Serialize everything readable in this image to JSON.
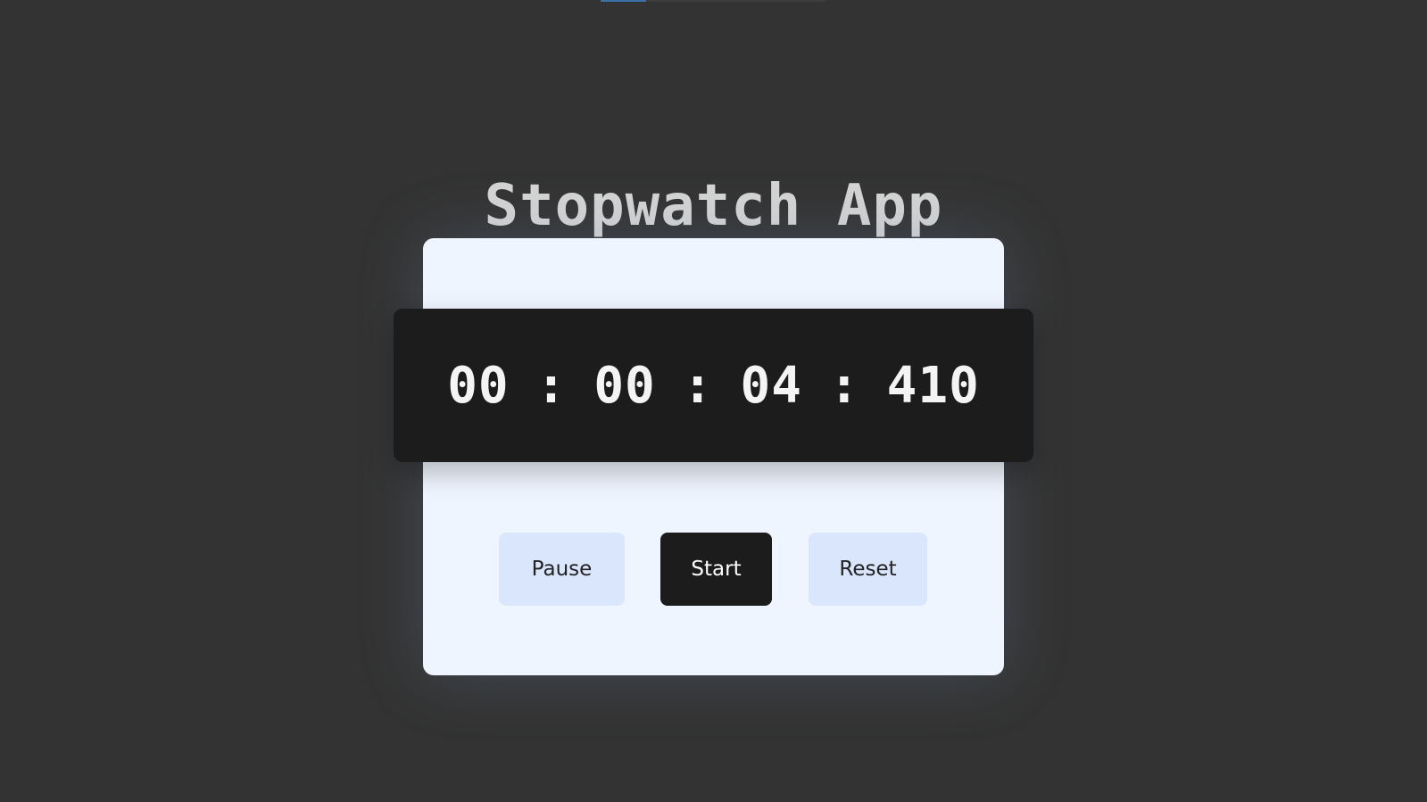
{
  "app": {
    "title": "Stopwatch App"
  },
  "display": {
    "hours": "00",
    "minutes": "00",
    "seconds": "04",
    "milliseconds": "410",
    "separator": ":"
  },
  "buttons": {
    "pause_label": "Pause",
    "start_label": "Start",
    "reset_label": "Reset"
  },
  "colors": {
    "background": "#333333",
    "card": "#eff5ff",
    "display_bg": "#1c1c1c",
    "secondary_button": "#d9e6fb",
    "primary_button": "#1c1c1c"
  }
}
